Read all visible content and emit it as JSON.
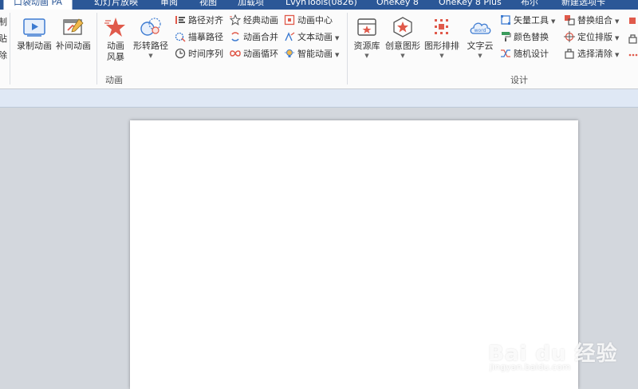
{
  "tabs": [
    {
      "label": "口袋动画 PA",
      "active": true
    },
    {
      "label": "幻灯片放映"
    },
    {
      "label": "审阅"
    },
    {
      "label": "视图"
    },
    {
      "label": "加载项"
    },
    {
      "label": "LvyhTools(0826)"
    },
    {
      "label": "OneKey 8"
    },
    {
      "label": "OneKey 8 Plus"
    },
    {
      "label": "布尔"
    },
    {
      "label": "新建选项卡"
    }
  ],
  "left_cut": [
    "制",
    "贴",
    "除"
  ],
  "groups": {
    "animation": {
      "label": "动画",
      "big_buttons": {
        "record": "录制动画",
        "tween": "补间动画",
        "storm_line1": "动画",
        "storm_line2": "风暴",
        "morph_path": "形转路径"
      },
      "col1": {
        "align_path": "路径对齐",
        "trace_path": "描摹路径",
        "timeline": "时间序列"
      },
      "col2": {
        "classic": "经典动画",
        "merge": "动画合并",
        "loop": "动画循环"
      },
      "col3": {
        "center": "动画中心",
        "text_anim": "文本动画",
        "smart": "智能动画"
      }
    },
    "design": {
      "label": "设计",
      "big_buttons": {
        "library": "资源库",
        "creative": "创意图形",
        "layout": "图形排排",
        "wordcloud": "文字云",
        "wordcloud_icon_text": "word"
      },
      "col1": {
        "vector": "矢量工具",
        "color_replace": "颜色替换",
        "random": "随机设计"
      },
      "col2": {
        "replace_combo": "替换组合",
        "position": "定位排版",
        "select_clear": "选择清除"
      }
    }
  },
  "watermark": {
    "brand": "Bai du 经验",
    "url": "jingyan.baidu.com"
  },
  "colors": {
    "accent": "#2b5797",
    "red_icon": "#e05a4b",
    "blue_icon": "#3d7bd1"
  }
}
